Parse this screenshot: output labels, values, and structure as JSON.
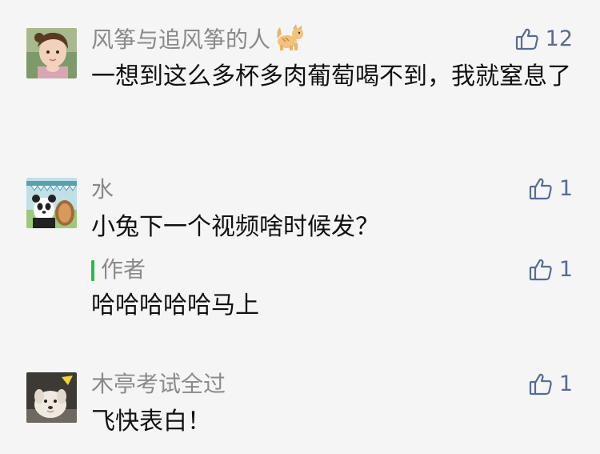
{
  "comments": [
    {
      "nickname": "风筝与追风筝的人",
      "nickname_emoji": "cat-emoji-icon",
      "likes": "12",
      "content": "一想到这么多杯多肉葡萄喝不到，我就窒息了",
      "avatar": "avatar-girl"
    },
    {
      "nickname": "水",
      "likes": "1",
      "content": "小兔下一个视频啥时候发？",
      "avatar": "avatar-panda",
      "reply": {
        "label": "作者",
        "likes": "1",
        "content": "哈哈哈哈哈马上"
      }
    },
    {
      "nickname": "木亭考试全过",
      "likes": "1",
      "content": "飞快表白！",
      "avatar": "avatar-dog"
    }
  ],
  "colors": {
    "background": "#f5f5f5",
    "nickname": "#8a8a8a",
    "like": "#576b95",
    "author_bar": "#21c04a"
  }
}
